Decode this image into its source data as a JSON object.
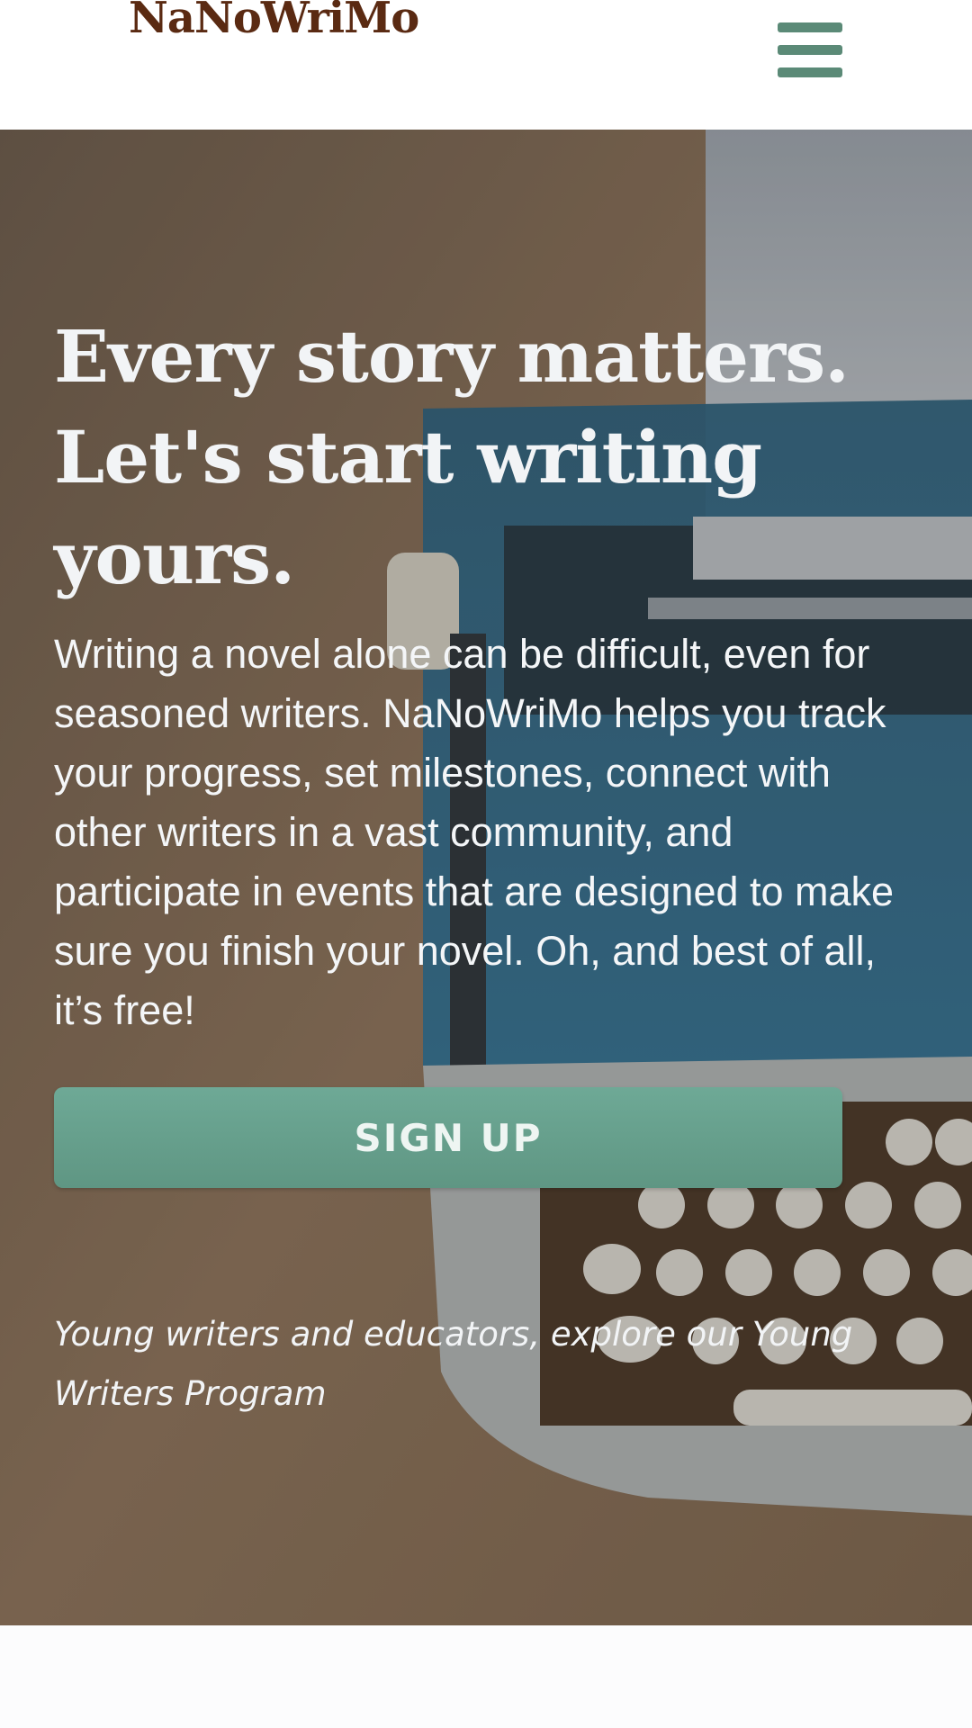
{
  "header": {
    "logo_text": "NaNoWriMo",
    "menu_icon": "hamburger-menu-icon",
    "menu_color": "#5b8a77"
  },
  "hero": {
    "background_image": "typewriter-photo",
    "headline_line1": "Every story matters.",
    "headline_line2": "Let's start writing",
    "headline_line3": "yours.",
    "intro_text": "Writing a novel alone can be difficult, even for seasoned writers. NaNoWriMo helps you track your progress, set milestones, connect with other writers in a vast community, and participate in events that are designed to make sure you finish your novel. Oh, and best of all, it’s free!",
    "signup_label": "SIGN UP",
    "ywp_prefix": "Young writers and educators, explore our ",
    "ywp_link_label": "Young Writers Program"
  },
  "colors": {
    "brand_brown": "#5a2a12",
    "accent_green": "#6ea996",
    "hero_text": "#f2f4f6"
  }
}
